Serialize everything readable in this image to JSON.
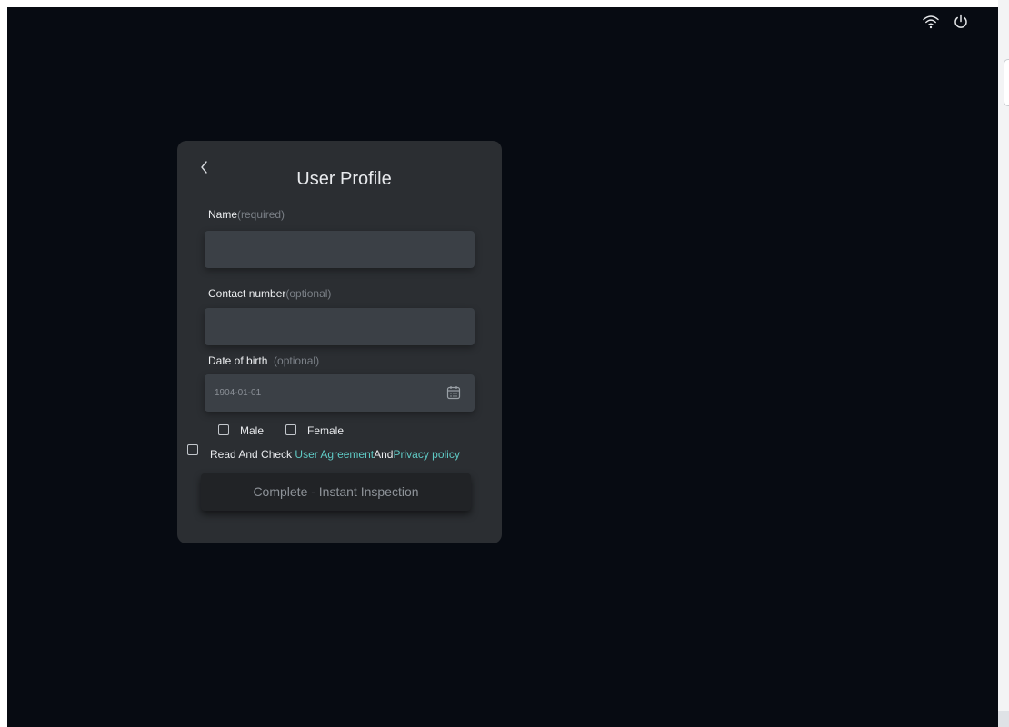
{
  "status_bar": {
    "wifi_icon": "wifi-icon",
    "power_icon": "power-icon"
  },
  "profile": {
    "title": "User Profile",
    "name_label": "Name",
    "name_hint": "(required)",
    "name_value": "",
    "contact_label": "Contact number",
    "contact_hint": "(optional)",
    "contact_value": "",
    "dob_label": "Date of birth",
    "dob_hint": "(optional)",
    "dob_value": "1904-01-01",
    "gender_male": "Male",
    "gender_female": "Female",
    "agree_prefix": "Read And Check ",
    "agreement_link": "User Agreement",
    "agree_and": "And",
    "privacy_link": "Privacy policy",
    "submit_label": "Complete - Instant Inspection"
  },
  "colors": {
    "background": "#070b12",
    "card": "#2b2e32",
    "input": "#3b4046",
    "link": "#5fc9c4",
    "button": "#212326"
  }
}
